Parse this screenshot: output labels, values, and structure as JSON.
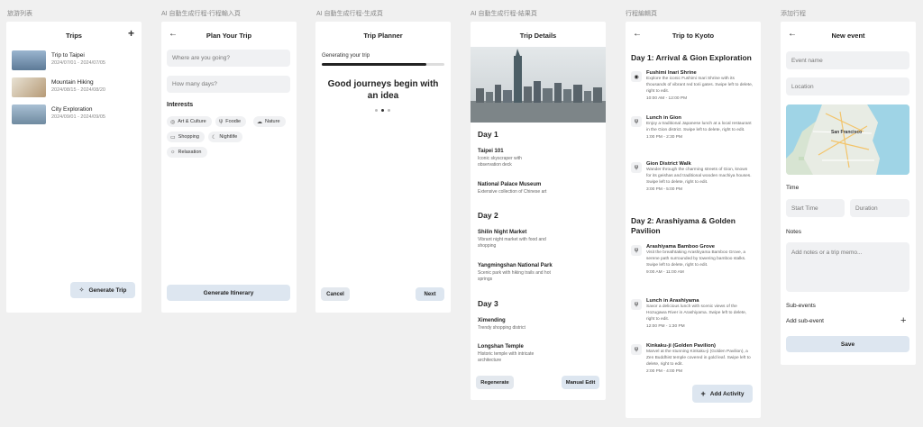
{
  "frames": [
    {
      "label": "旅游列表"
    },
    {
      "label": "AI 自動生成行程-行程輸入頁"
    },
    {
      "label": "AI 自動生成行程-生成頁"
    },
    {
      "label": "AI 自動生成行程-結果頁"
    },
    {
      "label": "行程編輯頁"
    },
    {
      "label": "添加行程"
    }
  ],
  "trips_screen": {
    "title": "Trips",
    "trips": [
      {
        "name": "Trip to Taipei",
        "dates": "2024/07/01 - 2024/07/05"
      },
      {
        "name": "Mountain Hiking",
        "dates": "2024/08/15 - 2024/08/20"
      },
      {
        "name": "City Exploration",
        "dates": "2024/09/01 - 2024/09/05"
      }
    ],
    "generate_label": "Generate Trip"
  },
  "plan_screen": {
    "title": "Plan Your Trip",
    "where_placeholder": "Where are you going?",
    "days_placeholder": "How many days?",
    "interests_heading": "Interests",
    "interests": [
      {
        "label": "Art & Culture",
        "icon": "palette-icon"
      },
      {
        "label": "Foodie",
        "icon": "fork-knife-icon"
      },
      {
        "label": "Nature",
        "icon": "cloud-icon"
      },
      {
        "label": "Shopping",
        "icon": "cart-icon"
      },
      {
        "label": "Nightlife",
        "icon": "moon-icon"
      },
      {
        "label": "Relaxation",
        "icon": "sun-icon"
      }
    ],
    "generate_label": "Generate Itinerary"
  },
  "planner_screen": {
    "title": "Trip Planner",
    "status": "Generating your trip",
    "progress": 0.85,
    "headline": "Good journeys begin with an idea",
    "cancel_label": "Cancel",
    "next_label": "Next"
  },
  "details_screen": {
    "title": "Trip Details",
    "days": [
      {
        "label": "Day 1",
        "places": [
          {
            "name": "Taipei 101",
            "desc": "Iconic skyscraper with observation deck"
          },
          {
            "name": "National Palace Museum",
            "desc": "Extensive collection of Chinese art"
          }
        ]
      },
      {
        "label": "Day 2",
        "places": [
          {
            "name": "Shilin Night Market",
            "desc": "Vibrant night market with food and shopping"
          },
          {
            "name": "Yangmingshan National Park",
            "desc": "Scenic park with hiking trails and hot springs"
          }
        ]
      },
      {
        "label": "Day 3",
        "places": [
          {
            "name": "Ximending",
            "desc": "Trendy shopping district"
          },
          {
            "name": "Longshan Temple",
            "desc": "Historic temple with intricate architecture"
          }
        ]
      }
    ],
    "regenerate_label": "Regenerate",
    "manual_label": "Manual Edit"
  },
  "kyoto_screen": {
    "title": "Trip to Kyoto",
    "days": [
      {
        "label": "Day 1: Arrival & Gion Exploration",
        "activities": [
          {
            "icon": "eye-icon",
            "name": "Fushimi Inari Shrine",
            "desc": "Explore the iconic Fushimi Inari Shrine with its thousands of vibrant red torii gates. Swipe left to delete, right to edit.",
            "time": "10:00 AM - 12:00 PM"
          },
          {
            "icon": "fork-knife-icon",
            "name": "Lunch in Gion",
            "desc": "Enjoy a traditional Japanese lunch at a local restaurant in the Gion district. Swipe left to delete, right to edit.",
            "time": "1:00 PM - 2:30 PM"
          },
          {
            "icon": "fork-knife-icon",
            "name": "Gion District Walk",
            "desc": "Wander through the charming streets of Gion, known for its geishas and traditional wooden machiya houses. Swipe left to delete, right to edit.",
            "time": "3:00 PM - 5:00 PM"
          }
        ]
      },
      {
        "label": "Day 2: Arashiyama & Golden Pavilion",
        "activities": [
          {
            "icon": "fork-knife-icon",
            "name": "Arashiyama Bamboo Grove",
            "desc": "Visit the breathtaking Arashiyama Bamboo Grove, a serene path surrounded by towering bamboo stalks. Swipe left to delete, right to edit.",
            "time": "9:00 AM - 11:00 AM"
          },
          {
            "icon": "fork-knife-icon",
            "name": "Lunch in Arashiyama",
            "desc": "Savor a delicious lunch with scenic views of the Hozugawa River in Arashiyama. Swipe left to delete, right to edit.",
            "time": "12:00 PM - 1:30 PM"
          },
          {
            "icon": "fork-knife-icon",
            "name": "Kinkaku-ji (Golden Pavilion)",
            "desc": "Marvel at the stunning Kinkaku-ji (Golden Pavilion), a Zen Buddhist temple covered in gold leaf. Swipe left to delete, right to edit.",
            "time": "2:00 PM - 4:00 PM"
          }
        ]
      }
    ],
    "add_label": "Add Activity"
  },
  "event_screen": {
    "title": "New event",
    "event_name_placeholder": "Event name",
    "location_placeholder": "Location",
    "map_label": "San Francisco",
    "time_heading": "Time",
    "start_placeholder": "Start Time",
    "duration_placeholder": "Duration",
    "notes_heading": "Notes",
    "notes_placeholder": "Add notes or a trip memo...",
    "subevents_heading": "Sub-events",
    "add_sub_label": "Add sub-event",
    "save_label": "Save"
  }
}
